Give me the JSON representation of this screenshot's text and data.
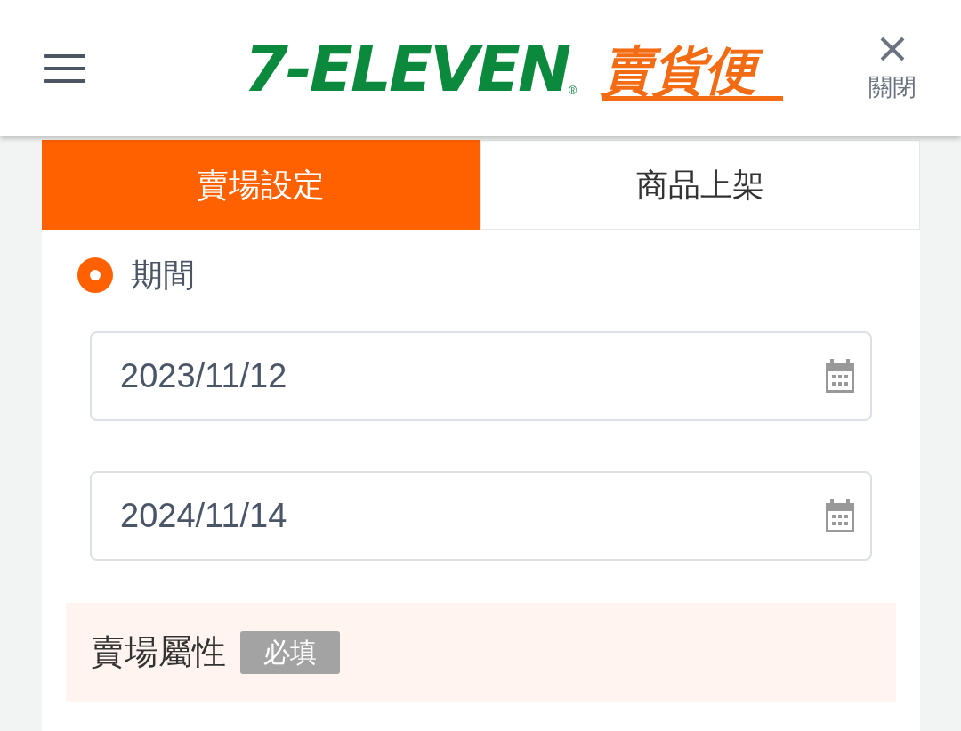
{
  "header": {
    "logo": {
      "brand": "7-ELEVEN",
      "registered": "®",
      "service": "賣貨便"
    },
    "close_label": "關閉"
  },
  "tabs": [
    {
      "label": "賣場設定",
      "selected": true
    },
    {
      "label": "商品上架",
      "selected": false
    }
  ],
  "period": {
    "label": "期間",
    "selected": true
  },
  "date_fields": [
    {
      "value": "2023/11/12"
    },
    {
      "value": "2024/11/14"
    }
  ],
  "section": {
    "title": "賣場屬性",
    "badge": "必填"
  }
}
